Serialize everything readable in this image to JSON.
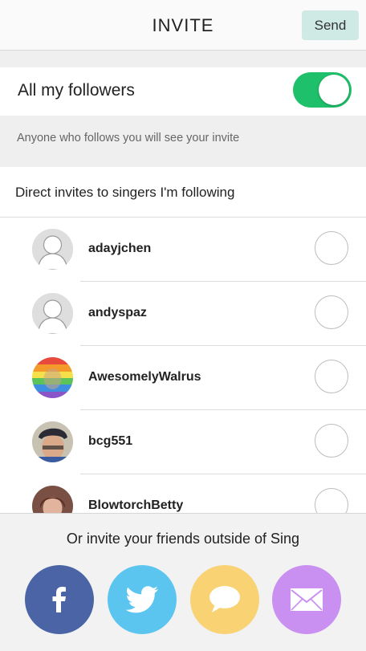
{
  "header": {
    "title": "INVITE",
    "send_label": "Send"
  },
  "followers": {
    "label": "All my followers",
    "toggle_on": true,
    "hint": "Anyone who follows you will see your invite"
  },
  "direct": {
    "label": "Direct invites to singers I'm following"
  },
  "users": [
    {
      "name": "adayjchen",
      "avatar": "default-avatar-icon"
    },
    {
      "name": "andyspaz",
      "avatar": "default-avatar-icon"
    },
    {
      "name": "AwesomelyWalrus",
      "avatar": "rainbow-photo"
    },
    {
      "name": "bcg551",
      "avatar": "photo"
    },
    {
      "name": "BlowtorchBetty",
      "avatar": "photo"
    }
  ],
  "footer": {
    "label": "Or invite your friends outside of Sing",
    "buttons": [
      {
        "name": "facebook",
        "icon": "facebook-icon",
        "color": "#4a64a6"
      },
      {
        "name": "twitter",
        "icon": "twitter-icon",
        "color": "#5bc5ef"
      },
      {
        "name": "message",
        "icon": "chat-bubble-icon",
        "color": "#f8d273"
      },
      {
        "name": "email",
        "icon": "envelope-icon",
        "color": "#c98ff1"
      }
    ]
  },
  "colors": {
    "toggle_on": "#1fc06b",
    "send_bg": "#cfe9e4"
  }
}
